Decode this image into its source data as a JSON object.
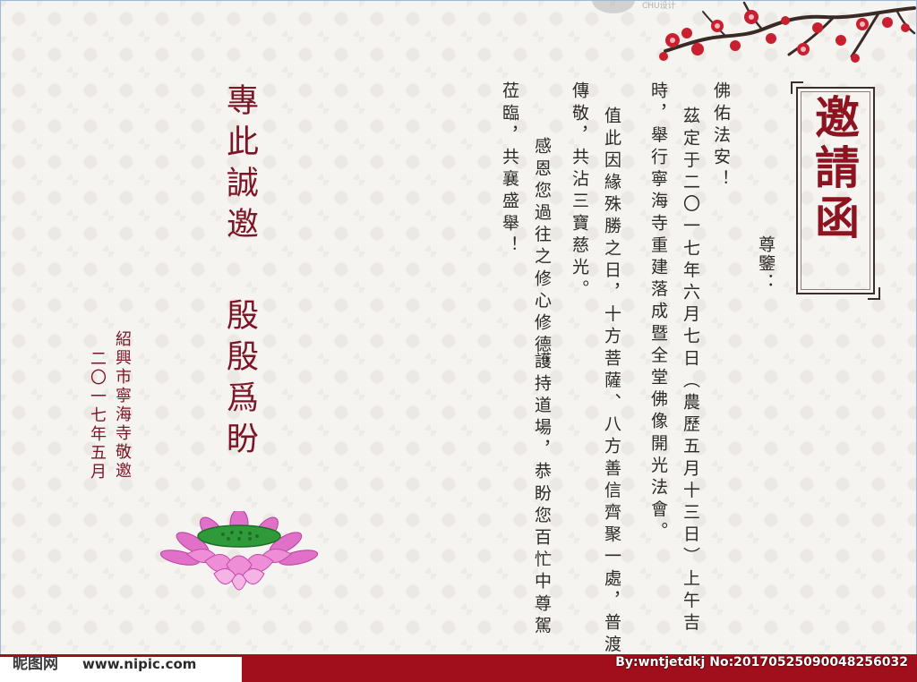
{
  "card": {
    "title": "邀請函",
    "honorific": "尊鑒：",
    "body_columns": [
      "佛佑法安！",
      "茲定于二〇一七年六月七日（農歷五月十三日）上午吉",
      "時，舉行寧海寺重建落成暨全堂佛像開光法會。",
      "值此因緣殊勝之日，十方菩薩、八方善信齊聚一處，普渡",
      "傳敬，共沾三寶慈光。",
      "感恩您過往之修心修德，",
      "護持道場，恭盼您百忙中尊駕",
      "莅臨，共襄盛舉！"
    ],
    "closing_lines": [
      "專此誠邀",
      "殷殷爲盼"
    ],
    "sender_lines": [
      "紹興市寧海寺敬邀",
      "二〇一七年五月"
    ],
    "decorations": {
      "branch": "plum-blossom-branch",
      "flower": "lotus-flower",
      "colors": {
        "title_red": "#8d1321",
        "closing_red": "#7c1525",
        "blossom": "#c8202e",
        "lotus_pink": "#e070c8",
        "lotus_center": "#2f9a3a",
        "background": "#f6f4f1"
      }
    }
  },
  "watermarks": {
    "top_small": "CHU设计",
    "brand": "昵图网",
    "url": "www.nipic.com",
    "id": "By:wntjetdkj No:20170525090048256032"
  }
}
